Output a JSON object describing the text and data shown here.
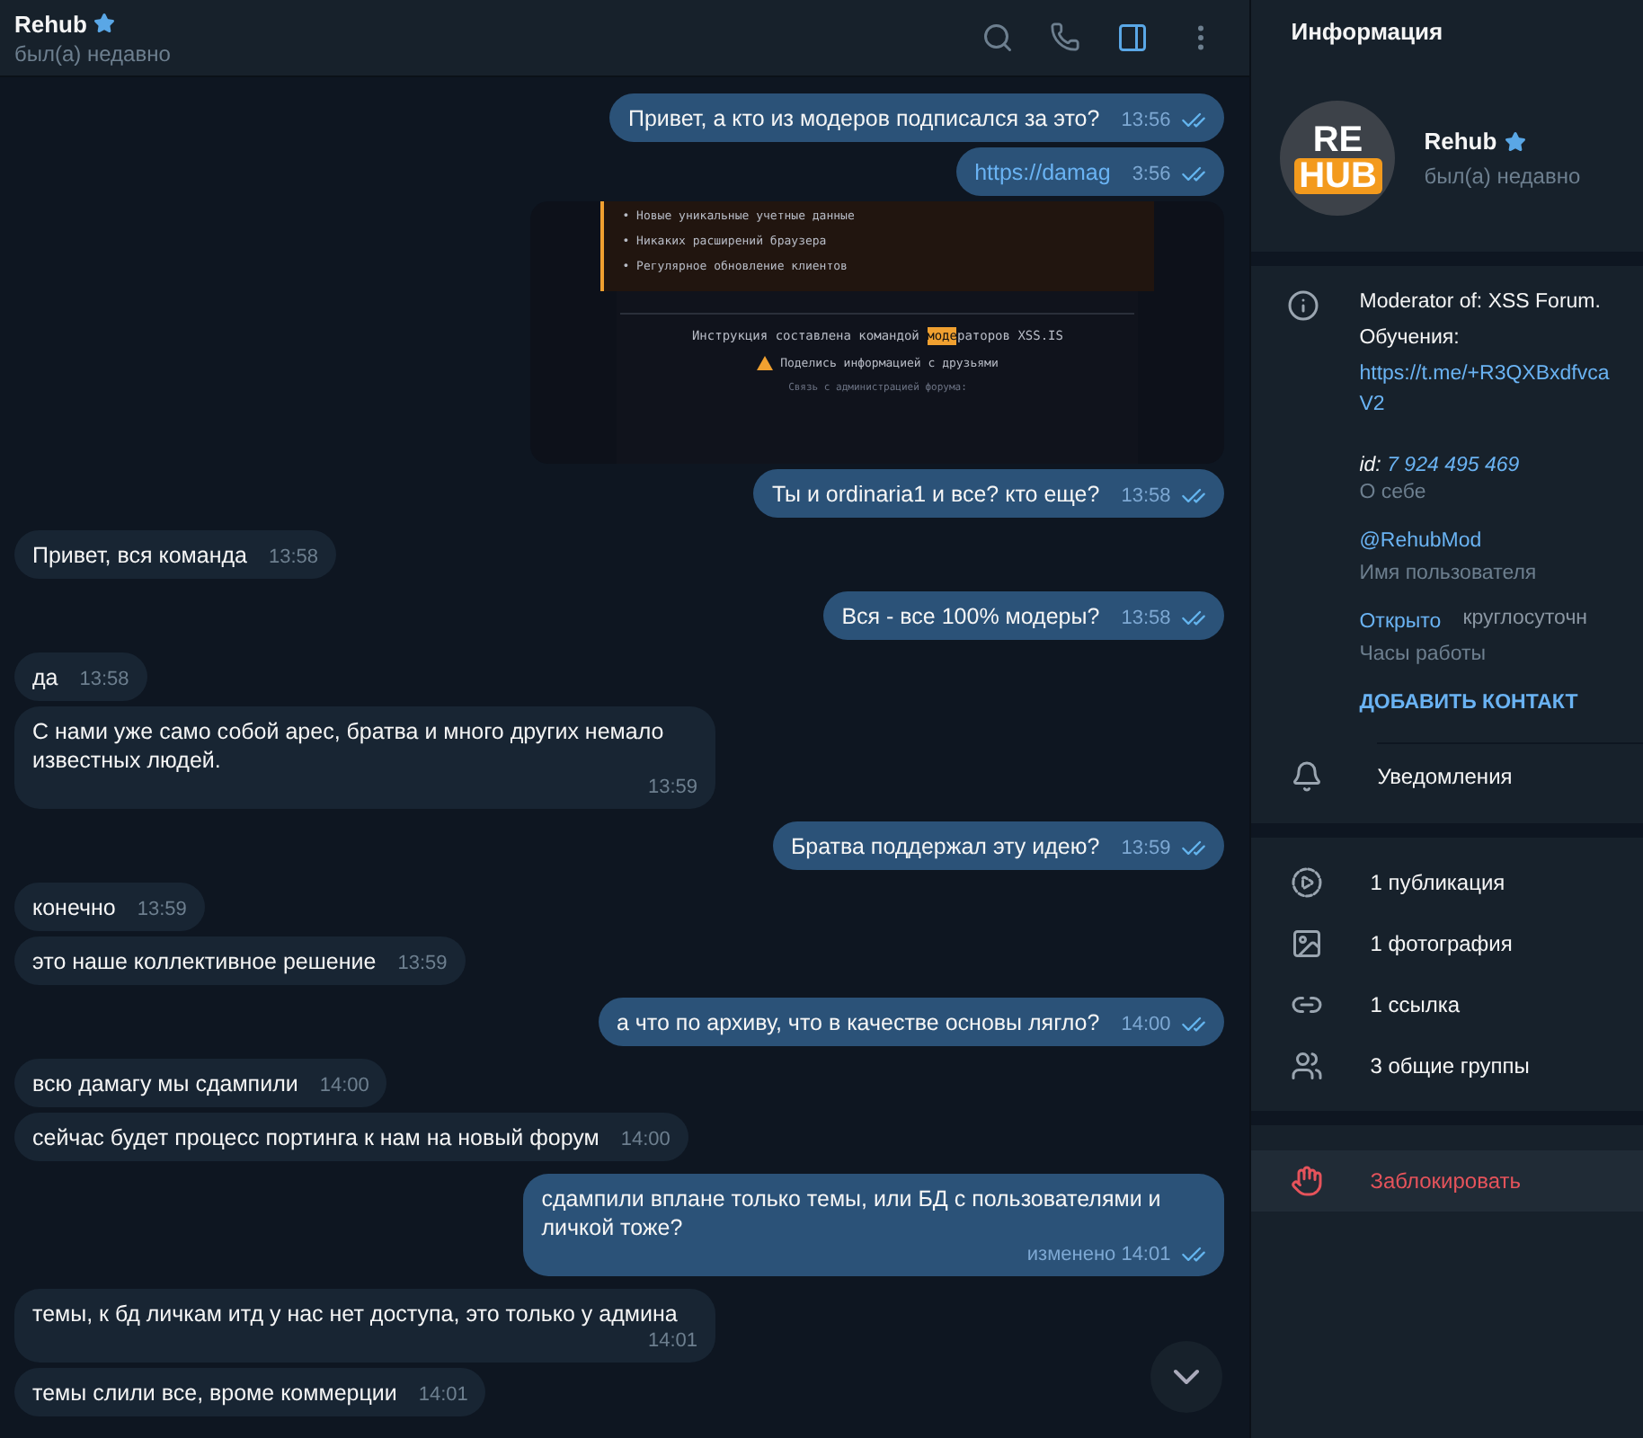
{
  "chat_header": {
    "name": "Rehub",
    "status": "был(а) недавно"
  },
  "messages": [
    {
      "kind": "out",
      "text": "Привет, а кто из модеров подписался за это?",
      "time": "13:56"
    },
    {
      "kind": "link",
      "text": "https://damag",
      "time": "3:56"
    },
    {
      "kind": "image",
      "lines": [
        "• Новые уникальные учетные данные",
        "• Никаких расширений браузера",
        "• Регулярное обновление клиентов"
      ],
      "credit_before": "Инструкция составлена командой ",
      "credit_mark": "моде",
      "credit_after": "раторов XSS.IS",
      "share": "Поделись информацией с друзьями",
      "contact": "Связь с администрацией форума:"
    },
    {
      "kind": "out",
      "text": "Ты и ordinaria1 и все? кто еще?",
      "time": "13:58"
    },
    {
      "kind": "in",
      "text": "Привет, вся команда",
      "time": "13:58"
    },
    {
      "kind": "out",
      "text": "Вся - все 100% модеры?",
      "time": "13:58"
    },
    {
      "kind": "in",
      "text": "да",
      "time": "13:58"
    },
    {
      "kind": "in",
      "text": "С нами уже само собой арес, братва и много других немало известных людей.",
      "time": "13:59"
    },
    {
      "kind": "out",
      "text": "Братва поддержал эту идею?",
      "time": "13:59"
    },
    {
      "kind": "in",
      "text": "конечно",
      "time": "13:59"
    },
    {
      "kind": "in",
      "text": "это наше коллективное решение",
      "time": "13:59"
    },
    {
      "kind": "out",
      "text": "а что по архиву, что в качестве основы лягло?",
      "time": "14:00"
    },
    {
      "kind": "in",
      "text": "всю дамагу мы сдампили",
      "time": "14:00"
    },
    {
      "kind": "in",
      "text": "сейчас будет процесс портинга к нам на новый форум",
      "time": "14:00"
    },
    {
      "kind": "out",
      "text": "сдампили вплане только темы, или БД с пользователями и личкой тоже?",
      "time": "изменено 14:01"
    },
    {
      "kind": "in",
      "text": "темы, к бд личкам итд у нас нет доступа, это только у админа",
      "time": "14:01"
    },
    {
      "kind": "in",
      "text": "темы слили все, вроме коммерции",
      "time": "14:01"
    }
  ],
  "info_panel": {
    "title": "Информация",
    "name": "Rehub",
    "status": "был(а) недавно",
    "avatar_top": "RE",
    "avatar_bottom": "HUB",
    "bio_lines": [
      "Moderator of: XSS Forum.",
      "Обучения:"
    ],
    "bio_link": "https://t.me/+R3QXBxdfvca",
    "bio_link_tail": "V2",
    "id_label": "id:",
    "id_value": "7 924 495 469",
    "bio_caption": "О себе",
    "username": "@RehubMod",
    "username_caption": "Имя пользователя",
    "hours_status": "Открыто",
    "hours_value": "круглосуточн",
    "hours_caption": "Часы работы",
    "add_contact": "ДОБАВИТЬ КОНТАКТ",
    "notifications": "Уведомления",
    "media": [
      {
        "kind": "posts",
        "label": "1 публикация"
      },
      {
        "kind": "photos",
        "label": "1 фотография"
      },
      {
        "kind": "links",
        "label": "1 ссылка"
      },
      {
        "kind": "groups",
        "label": "3 общие группы"
      }
    ],
    "block": "Заблокировать"
  }
}
